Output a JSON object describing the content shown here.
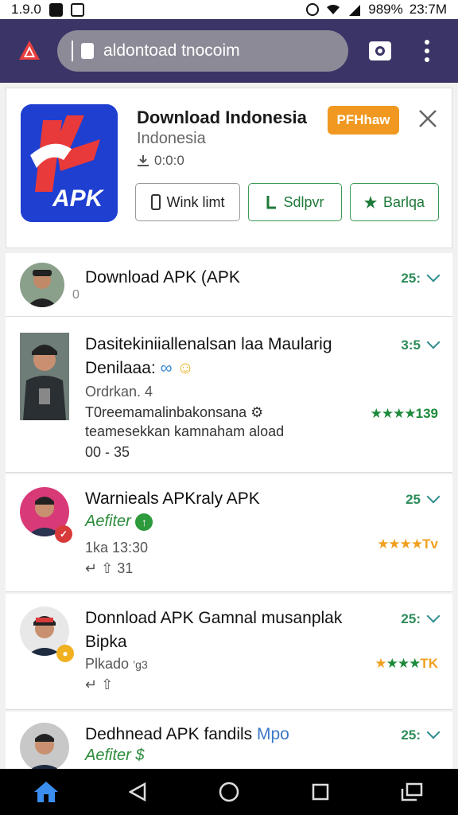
{
  "status_bar": {
    "time_left": "1.9.0",
    "battery": "989%",
    "time_right": "23:7M"
  },
  "browser": {
    "url": "aldontoad tnocoim"
  },
  "banner": {
    "title": "Download Indonesia",
    "subtitle": "Indonesia",
    "meta": "0:0:0",
    "follow_label": "PFHhaw",
    "app_icon_text": "APK",
    "buttons": [
      {
        "label": "Wink limt"
      },
      {
        "label": "Sdlpvr"
      },
      {
        "label": "Barlqa"
      }
    ]
  },
  "items": [
    {
      "title": "Download APK (APK",
      "sub": "0",
      "count": "25:"
    },
    {
      "title_line1": "Dasitekiniiallenalsan laa Maularig",
      "title_line2": "Denilaaa:",
      "line1": "Ordrkan. 4",
      "line2": "T0reemamalinbakonsana",
      "line3": "teamesekkan kamnaham aload",
      "line4": "00 - 35",
      "count": "3:5",
      "rating": "139"
    },
    {
      "title": "Warnieals APKraly APK",
      "green": "Aefiter",
      "line1": "1ka 13:30",
      "line2": "31",
      "count": "25",
      "rating": "Tv"
    },
    {
      "title_line1": "Donnload APK Gamnal musanplak",
      "title_line2": "Bipka",
      "line1": "Plkado",
      "line1b": "’g3",
      "count": "25:",
      "rating": "TK"
    },
    {
      "title_main": "Dedhnead APK fandils",
      "title_accent": "Mpo",
      "green": "Aefiter",
      "count": "25:"
    }
  ],
  "colors": {
    "browser_bar": "#3a3566",
    "follow_button": "#f0981f",
    "accent_green": "#2d8c3c",
    "star_orange": "#f0a020"
  }
}
